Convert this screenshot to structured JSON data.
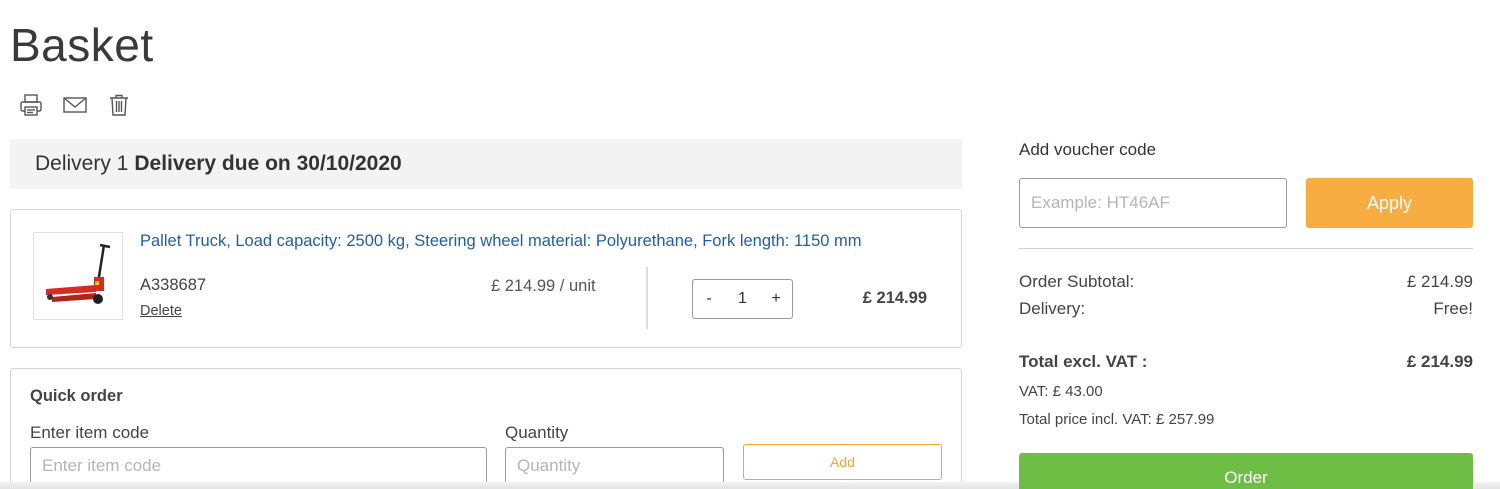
{
  "page": {
    "title": "Basket"
  },
  "actions": {
    "icons": [
      "print-icon",
      "email-icon",
      "trash-icon"
    ]
  },
  "delivery": {
    "number_label": "Delivery 1",
    "due_label": "Delivery due on 30/10/2020"
  },
  "item": {
    "title": "Pallet Truck, Load capacity: 2500 kg, Steering wheel material: Polyurethane, Fork length: 1150 mm",
    "sku": "A338687",
    "delete_label": "Delete",
    "unit_price": "£ 214.99  /  unit",
    "quantity": "1",
    "decrement": "-",
    "increment": "+",
    "line_total": "£ 214.99"
  },
  "quick_order": {
    "title": "Quick order",
    "code_label": "Enter item code",
    "code_placeholder": "Enter item code",
    "qty_label": "Quantity",
    "qty_placeholder": "Quantity",
    "add_label": "Add"
  },
  "voucher": {
    "label": "Add voucher code",
    "placeholder": "Example: HT46AF",
    "apply_label": "Apply"
  },
  "summary": {
    "subtotal_label": "Order Subtotal:",
    "subtotal_value": "£ 214.99",
    "delivery_label": "Delivery:",
    "delivery_value": "Free!",
    "total_label": "Total excl. VAT :",
    "total_value": "£ 214.99",
    "vat_line": "VAT: £ 43.00",
    "incl_vat_line": "Total price incl. VAT: £ 257.99",
    "order_label": "Order"
  },
  "colors": {
    "link": "#1f5fa8",
    "apply_button": "#f7ad42",
    "order_button": "#6ebd45",
    "add_outline": "#f5a623"
  }
}
